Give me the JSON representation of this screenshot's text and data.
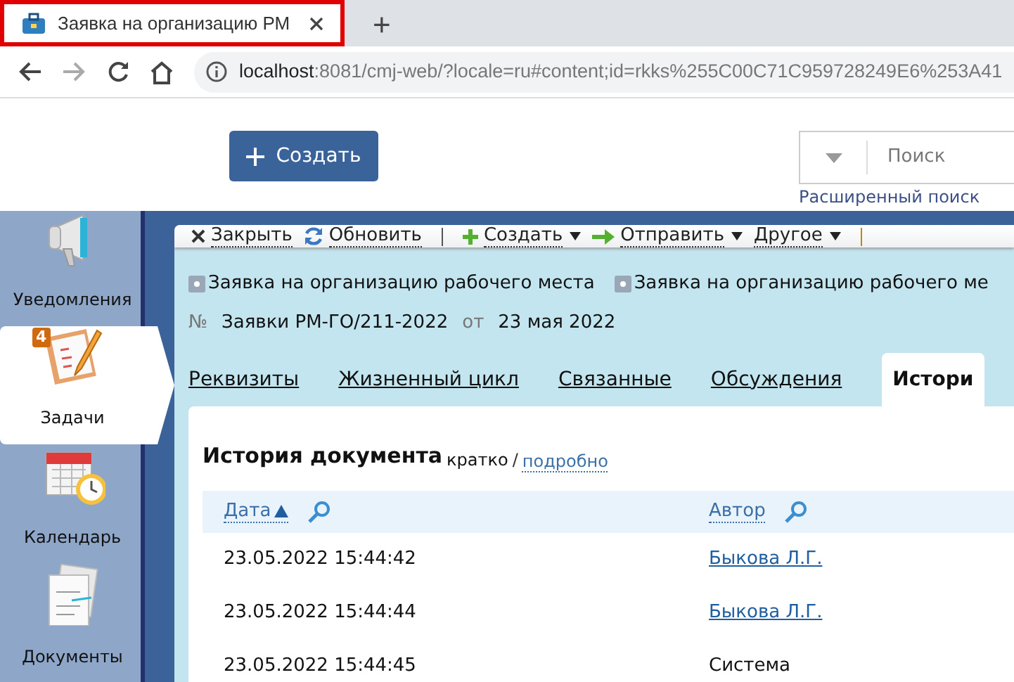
{
  "browser": {
    "tab_title": "Заявка на организацию РМ",
    "new_tab": "+",
    "url_host": "localhost",
    "url_rest": ":8081/cmj-web/?locale=ru#content;id=rkks%255C00C71C959728249E6%253A41"
  },
  "header": {
    "create_button": "Создать",
    "search": {
      "placeholder": "Поиск"
    },
    "advanced_search": "Расширенный поиск"
  },
  "sidebar": {
    "items": [
      {
        "label": "Уведомления",
        "kind": "notifications",
        "selected": false
      },
      {
        "label": "Задачи",
        "kind": "tasks",
        "selected": true,
        "badge": "4"
      },
      {
        "label": "Календарь",
        "kind": "calendar",
        "selected": false
      },
      {
        "label": "Документы",
        "kind": "documents",
        "selected": false
      }
    ]
  },
  "toolbar": {
    "items": [
      {
        "kind": "close",
        "label": "Закрыть"
      },
      {
        "kind": "refresh",
        "label": "Обновить"
      },
      {
        "kind": "separator",
        "color": "#555555"
      },
      {
        "kind": "create",
        "label": "Создать",
        "menu": true
      },
      {
        "kind": "send",
        "label": "Отправить",
        "menu": true
      },
      {
        "kind": "other",
        "label": "Другое",
        "menu": true
      },
      {
        "kind": "separator",
        "color": "#c08a00"
      }
    ]
  },
  "breadcrumbs": [
    "Заявка на организацию рабочего места",
    "Заявка на организацию рабочего ме"
  ],
  "document": {
    "number_label": "№",
    "number": "Заявки РМ-ГО/211-2022",
    "date_prefix": "от",
    "date": "23 мая 2022"
  },
  "tabs": [
    {
      "label": "Реквизиты",
      "selected": false
    },
    {
      "label": "Жизненный цикл",
      "selected": false
    },
    {
      "label": "Связанные",
      "selected": false
    },
    {
      "label": "Обсуждения",
      "selected": false
    },
    {
      "label": "Истори",
      "selected": true
    }
  ],
  "history": {
    "title": "История документа",
    "modes": [
      {
        "label": "кратко",
        "selected": true
      },
      {
        "label": "подробно",
        "selected": false
      }
    ],
    "mode_separator": "/",
    "columns": [
      {
        "label": "Дата",
        "sorted_ascending": true
      },
      {
        "label": "Автор",
        "sorted_ascending": false
      }
    ],
    "rows": [
      {
        "date": "23.05.2022 15:44:42",
        "author": "Быкова Л.Г.",
        "kind": "link"
      },
      {
        "date": "23.05.2022 15:44:44",
        "author": "Быкова Л.Г.",
        "kind": "link"
      },
      {
        "date": "23.05.2022 15:44:45",
        "author": "Система",
        "kind": "text"
      }
    ]
  }
}
